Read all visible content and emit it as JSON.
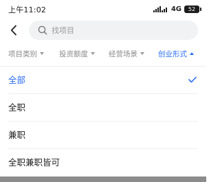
{
  "status_bar": {
    "time": "上午11:02",
    "network": "4G",
    "battery": "52",
    "icons": [
      "signal-icon",
      "battery-icon"
    ]
  },
  "header": {
    "back_icon": "chevron-left-icon",
    "search_icon": "search-icon",
    "search_placeholder": "找项目"
  },
  "filters": [
    {
      "label": "项目类别",
      "active": false,
      "caret": "down"
    },
    {
      "label": "投资额度",
      "active": false,
      "caret": "down"
    },
    {
      "label": "经营场景",
      "active": false,
      "caret": "down"
    },
    {
      "label": "创业形式",
      "active": true,
      "caret": "up"
    }
  ],
  "options": [
    {
      "label": "全部",
      "selected": true
    },
    {
      "label": "全职",
      "selected": false
    },
    {
      "label": "兼职",
      "selected": false
    },
    {
      "label": "全职兼职皆可",
      "selected": false
    }
  ],
  "colors": {
    "accent": "#2a6df4",
    "text": "#222222",
    "muted": "#8a8a8a",
    "search_bg": "#f1f2f4"
  }
}
